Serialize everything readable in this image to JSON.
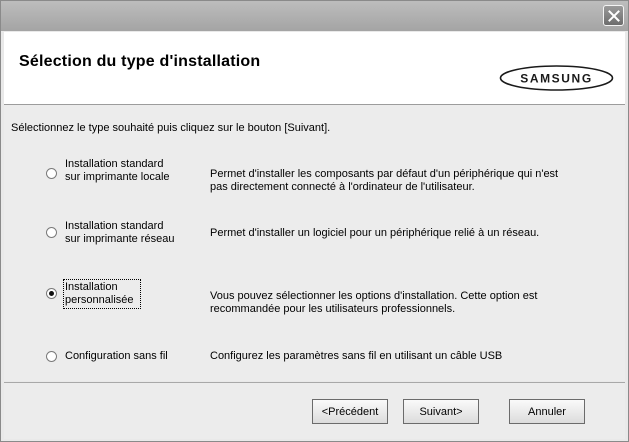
{
  "header": {
    "title": "Sélection du type d'installation",
    "logo_text": "SAMSUNG"
  },
  "instruction": "Sélectionnez le type souhaité puis cliquez sur le bouton [Suivant].",
  "options": [
    {
      "label_line1": "Installation standard",
      "label_line2": "sur imprimante locale",
      "desc_line1": "Permet d'installer les composants par défaut d'un périphérique qui n'est",
      "desc_line2": "pas directement connecté à l'ordinateur de l'utilisateur.",
      "checked": false
    },
    {
      "label_line1": "Installation standard",
      "label_line2": "sur imprimante réseau",
      "desc_line1": "Permet d'installer un logiciel pour un périphérique relié à un réseau.",
      "desc_line2": "",
      "checked": false
    },
    {
      "label_line1": "Installation",
      "label_line2": "personnalisée",
      "desc_line1": "Vous pouvez sélectionner les options d'installation. Cette option est",
      "desc_line2": "recommandée pour les utilisateurs professionnels.",
      "checked": true
    },
    {
      "label_line1": "Configuration sans fil",
      "label_line2": "",
      "desc_line1": "Configurez les paramètres sans fil en utilisant un câble USB",
      "desc_line2": "",
      "checked": false
    }
  ],
  "buttons": {
    "back": "<Précédent",
    "next": "Suivant>",
    "cancel": "Annuler"
  },
  "icons": {
    "close": "close-icon"
  }
}
